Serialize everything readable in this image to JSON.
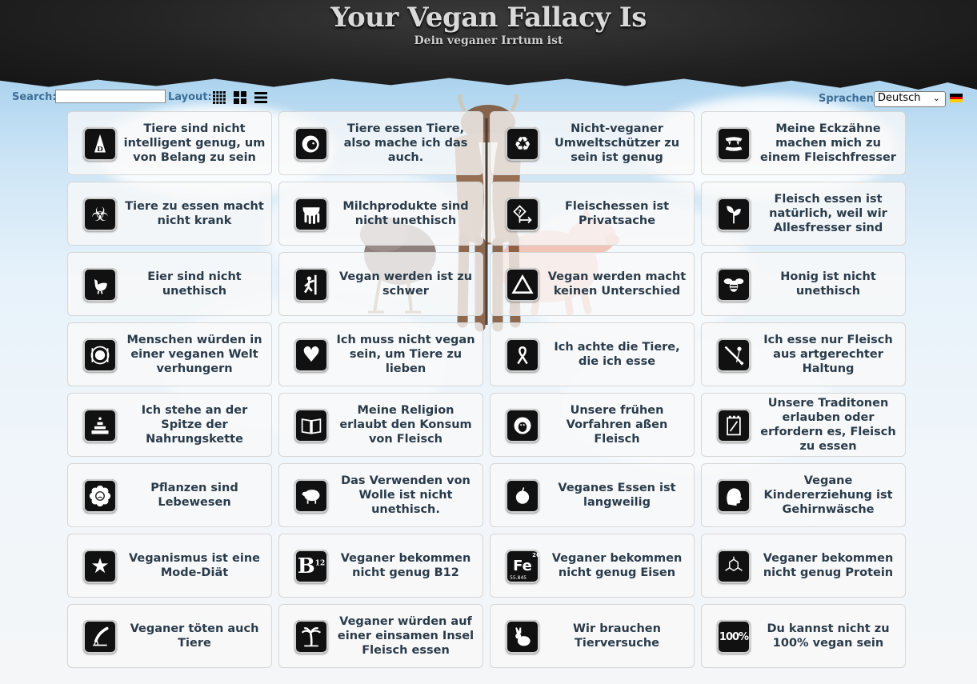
{
  "header": {
    "title": "Your Vegan Fallacy Is",
    "subtitle": "Dein veganer Irrtum ist"
  },
  "toolbar": {
    "search_label": "Search:",
    "search_value": "",
    "layout_label": "Layout:",
    "layout_options": [
      "small-grid-icon",
      "large-grid-icon",
      "list-icon"
    ],
    "language_label": "Sprachen",
    "language_selected": "Deutsch",
    "flag": "german-flag-icon"
  },
  "colors": {
    "label_blue": "#3d6e96",
    "card_text": "#2a3b4a",
    "icon_bg": "#111111"
  },
  "fallacies": [
    {
      "label": "Tiere sind nicht intelligent genug, um von Belang zu sein",
      "icon": "dunce-cap-icon"
    },
    {
      "label": "Tiere essen Tiere, also mache ich das auch.",
      "icon": "lion-icon"
    },
    {
      "label": "Nicht-veganer Umweltschützer zu sein ist genug",
      "icon": "recycle-icon"
    },
    {
      "label": "Meine Eckzähne machen mich zu einem Fleischfresser",
      "icon": "fangs-icon"
    },
    {
      "label": "Tiere zu essen macht nicht krank",
      "icon": "biohazard-icon"
    },
    {
      "label": "Milchprodukte sind nicht unethisch",
      "icon": "udder-icon"
    },
    {
      "label": "Fleischessen ist Privatsache",
      "icon": "choice-sign-icon"
    },
    {
      "label": "Fleisch essen ist natürlich, weil wir Allesfresser sind",
      "icon": "plant-icon"
    },
    {
      "label": "Eier sind nicht unethisch",
      "icon": "hen-icon"
    },
    {
      "label": "Vegan werden ist zu schwer",
      "icon": "climber-icon"
    },
    {
      "label": "Vegan werden macht keinen Unterschied",
      "icon": "delta-icon"
    },
    {
      "label": "Honig ist nicht unethisch",
      "icon": "bee-icon"
    },
    {
      "label": "Menschen würden in einer veganen Welt verhungern",
      "icon": "plate-icon"
    },
    {
      "label": "Ich muss nicht vegan sein, um Tiere zu lieben",
      "icon": "heart-icon"
    },
    {
      "label": "Ich achte die Tiere, die ich esse",
      "icon": "ribbon-icon"
    },
    {
      "label": "Ich esse nur Fleisch aus artgerechter Haltung",
      "icon": "knife-flower-icon"
    },
    {
      "label": "Ich stehe an der Spitze der Nahrungskette",
      "icon": "pyramid-icon"
    },
    {
      "label": "Meine Religion erlaubt den Konsum von Fleisch",
      "icon": "book-icon"
    },
    {
      "label": "Unsere frühen Vorfahren aßen Fleisch",
      "icon": "caveman-icon"
    },
    {
      "label": "Unsere Traditonen erlauben oder erfordern es, Fleisch zu essen",
      "icon": "scroll-icon"
    },
    {
      "label": "Pflanzen sind Lebewesen",
      "icon": "sad-flower-icon"
    },
    {
      "label": "Das Verwenden von Wolle ist nicht unethisch.",
      "icon": "sheep-icon"
    },
    {
      "label": "Veganes Essen ist langweilig",
      "icon": "apple-icon"
    },
    {
      "label": "Vegane Kindererziehung ist Gehirnwäsche",
      "icon": "head-icon"
    },
    {
      "label": "Veganismus ist eine Mode-Diät",
      "icon": "star-icon"
    },
    {
      "label": "Veganer bekommen nicht genug B12",
      "icon": "b12-icon"
    },
    {
      "label": "Veganer bekommen nicht genug Eisen",
      "icon": "iron-icon"
    },
    {
      "label": "Veganer bekommen nicht genug Protein",
      "icon": "molecule-icon"
    },
    {
      "label": "Veganer töten auch Tiere",
      "icon": "harvester-icon"
    },
    {
      "label": "Veganer würden auf einer einsamen Insel Fleisch essen",
      "icon": "palm-tree-icon"
    },
    {
      "label": "Wir brauchen Tierversuche",
      "icon": "rabbit-icon"
    },
    {
      "label": "Du kannst nicht zu 100% vegan sein",
      "icon": "percent-icon"
    }
  ],
  "icon_glyphs": {
    "b12": "B",
    "b12_sup": "12",
    "iron": "Fe",
    "iron_num": "26",
    "iron_mass": "55.845",
    "percent": "100%"
  }
}
